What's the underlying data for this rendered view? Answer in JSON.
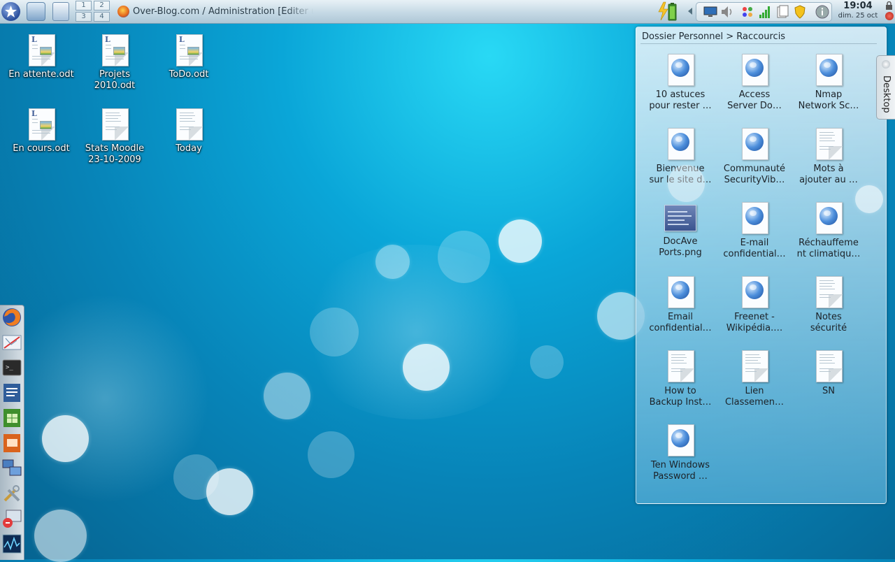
{
  "top_panel": {
    "pager": [
      "1",
      "2",
      "3",
      "4"
    ],
    "task": {
      "label": "Over-Blog.com / Administration [Éditer un A"
    },
    "clock": {
      "time": "19:04",
      "date": "dim. 25 oct"
    }
  },
  "desktop_icons": [
    {
      "label": "En attente.odt",
      "kind": "odt-image"
    },
    {
      "label": "Projets\n2010.odt",
      "kind": "odt-image"
    },
    {
      "label": "ToDo.odt",
      "kind": "odt-image"
    },
    {
      "label": "En cours.odt",
      "kind": "odt-image"
    },
    {
      "label": "Stats Moodle\n23-10-2009",
      "kind": "text"
    },
    {
      "label": "Today",
      "kind": "text"
    }
  ],
  "folder_view": {
    "title": "Dossier Personnel > Raccourcis",
    "items": [
      {
        "label": "10 astuces\npour rester …",
        "kind": "web"
      },
      {
        "label": "Access\nServer Do…",
        "kind": "web"
      },
      {
        "label": "Nmap\nNetwork Sc…",
        "kind": "web"
      },
      {
        "label": "Bienvenue\nsur le site d…",
        "kind": "web"
      },
      {
        "label": "Communauté\nSecurityVib…",
        "kind": "web"
      },
      {
        "label": "Mots à\najouter au …",
        "kind": "text"
      },
      {
        "label": "DocAve\nPorts.png",
        "kind": "image"
      },
      {
        "label": "E-mail\nconfidential…",
        "kind": "web"
      },
      {
        "label": "Réchauffeme\nnt climatiqu…",
        "kind": "web"
      },
      {
        "label": "Email\nconfidential…",
        "kind": "web"
      },
      {
        "label": "Freenet -\nWikipédia.…",
        "kind": "web"
      },
      {
        "label": "Notes\nsécurité",
        "kind": "text"
      },
      {
        "label": "How to\nBackup Inst…",
        "kind": "text"
      },
      {
        "label": "Lien\nClassemen…",
        "kind": "text"
      },
      {
        "label": "SN",
        "kind": "text"
      },
      {
        "label": "Ten Windows\nPassword …",
        "kind": "web"
      }
    ]
  },
  "desktop_tab": {
    "label": "Desktop"
  },
  "dock": {
    "items": [
      "firefox-icon",
      "network-map-icon",
      "terminal-icon",
      "writer-icon",
      "calc-icon",
      "impress-icon",
      "remote-desktop-icon",
      "tools-icon",
      "system-monitor-icon",
      "activity-monitor-icon"
    ]
  }
}
